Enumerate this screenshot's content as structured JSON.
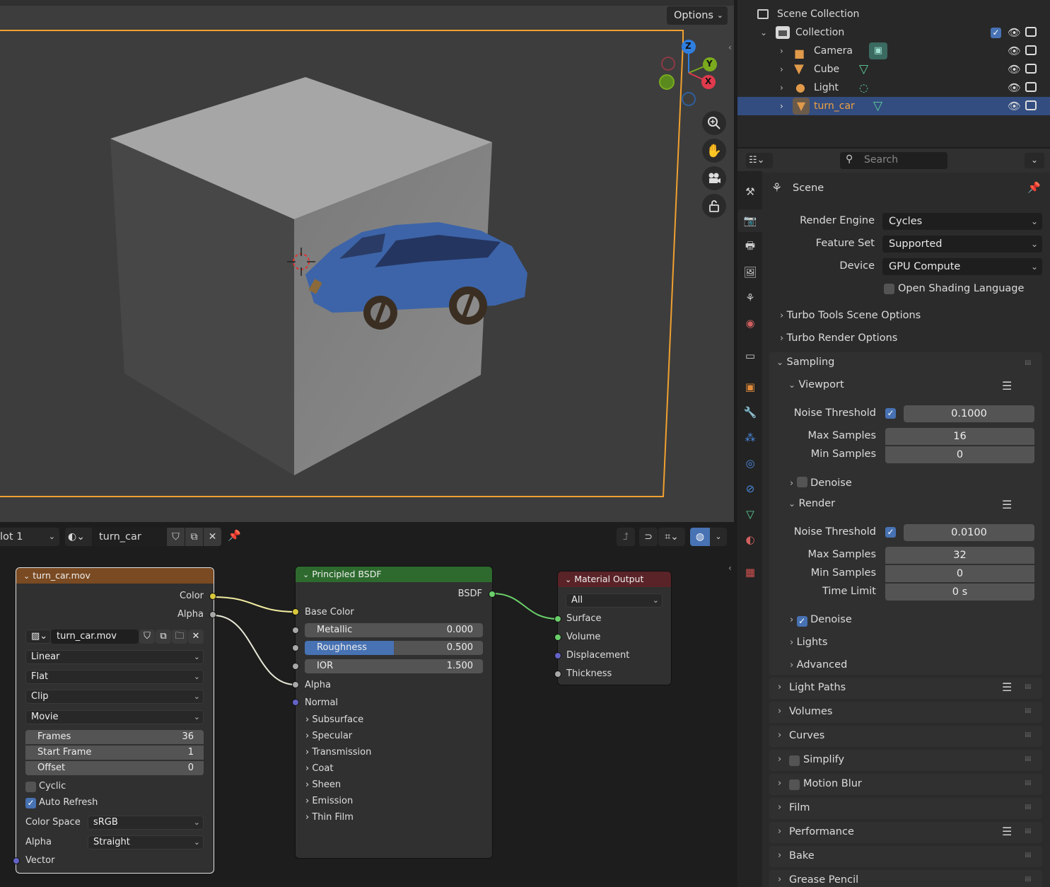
{
  "viewport": {
    "options_label": "Options",
    "gizmo": {
      "z": "Z",
      "y": "Y",
      "x": "X"
    }
  },
  "outliner": {
    "scene_collection": "Scene Collection",
    "collection": "Collection",
    "items": [
      {
        "label": "Camera",
        "icon": "camera-icon",
        "data_icon": "camera-data-icon"
      },
      {
        "label": "Cube",
        "icon": "mesh-object-icon",
        "data_icon": "mesh-data-icon"
      },
      {
        "label": "Light",
        "icon": "light-object-icon",
        "data_icon": "light-data-icon"
      },
      {
        "label": "turn_car",
        "icon": "mesh-object-icon",
        "data_icon": "mesh-data-icon",
        "selected": true
      }
    ]
  },
  "properties": {
    "search_placeholder": "Search",
    "context_title": "Scene",
    "render_engine_label": "Render Engine",
    "render_engine_value": "Cycles",
    "feature_set_label": "Feature Set",
    "feature_set_value": "Supported",
    "device_label": "Device",
    "device_value": "GPU Compute",
    "osl_label": "Open Shading Language",
    "turbo_scene": "Turbo Tools Scene Options",
    "turbo_render": "Turbo Render Options",
    "sampling": {
      "title": "Sampling",
      "viewport": {
        "title": "Viewport",
        "noise_threshold_label": "Noise Threshold",
        "noise_threshold": "0.1000",
        "max_samples_label": "Max Samples",
        "max_samples": "16",
        "min_samples_label": "Min Samples",
        "min_samples": "0",
        "denoise_label": "Denoise"
      },
      "render": {
        "title": "Render",
        "noise_threshold_label": "Noise Threshold",
        "noise_threshold": "0.0100",
        "max_samples_label": "Max Samples",
        "max_samples": "32",
        "min_samples_label": "Min Samples",
        "min_samples": "0",
        "time_limit_label": "Time Limit",
        "time_limit": "0 s",
        "denoise_label": "Denoise"
      },
      "lights": "Lights",
      "advanced": "Advanced"
    },
    "panels": [
      "Light Paths",
      "Volumes",
      "Curves",
      "Simplify",
      "Motion Blur",
      "Film",
      "Performance",
      "Bake",
      "Grease Pencil"
    ]
  },
  "node_header": {
    "slot": "lot 1",
    "material": "turn_car"
  },
  "nodes": {
    "image": {
      "title": "turn_car.mov",
      "out_color": "Color",
      "out_alpha": "Alpha",
      "image_name": "turn_car.mov",
      "interpolation": "Linear",
      "projection": "Flat",
      "extension": "Clip",
      "source": "Movie",
      "frames_label": "Frames",
      "frames": "36",
      "start_label": "Start Frame",
      "start": "1",
      "offset_label": "Offset",
      "offset": "0",
      "cyclic": "Cyclic",
      "auto_refresh": "Auto Refresh",
      "color_space_label": "Color Space",
      "color_space": "sRGB",
      "alpha_label": "Alpha",
      "alpha": "Straight",
      "vector": "Vector"
    },
    "bsdf": {
      "title": "Principled BSDF",
      "out": "BSDF",
      "base_color": "Base Color",
      "metallic_label": "Metallic",
      "metallic": "0.000",
      "roughness_label": "Roughness",
      "roughness": "0.500",
      "roughness_fraction": 0.5,
      "ior_label": "IOR",
      "ior": "1.500",
      "alpha": "Alpha",
      "normal": "Normal",
      "sections": [
        "Subsurface",
        "Specular",
        "Transmission",
        "Coat",
        "Sheen",
        "Emission",
        "Thin Film"
      ]
    },
    "output": {
      "title": "Material Output",
      "target": "All",
      "surface": "Surface",
      "volume": "Volume",
      "displacement": "Displacement",
      "thickness": "Thickness"
    }
  },
  "colors": {
    "selection": "#334d80",
    "accent": "#4772b3",
    "orange_outline": "#f0a030"
  }
}
